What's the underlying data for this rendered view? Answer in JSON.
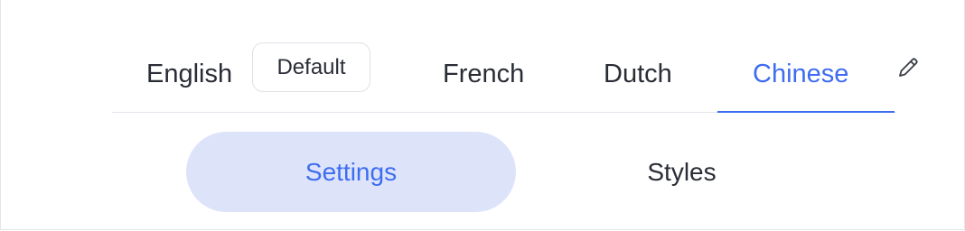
{
  "language_tabs": {
    "items": [
      {
        "label": "English",
        "badge": "Default"
      },
      {
        "label": "French"
      },
      {
        "label": "Dutch"
      },
      {
        "label": "Chinese",
        "active": true
      }
    ],
    "edit_icon": "pencil-icon",
    "active_color": "#3f6df0"
  },
  "segments": {
    "items": [
      {
        "label": "Settings",
        "selected": true
      },
      {
        "label": "Styles",
        "selected": false
      }
    ],
    "selected_bg": "#dde4fa"
  }
}
